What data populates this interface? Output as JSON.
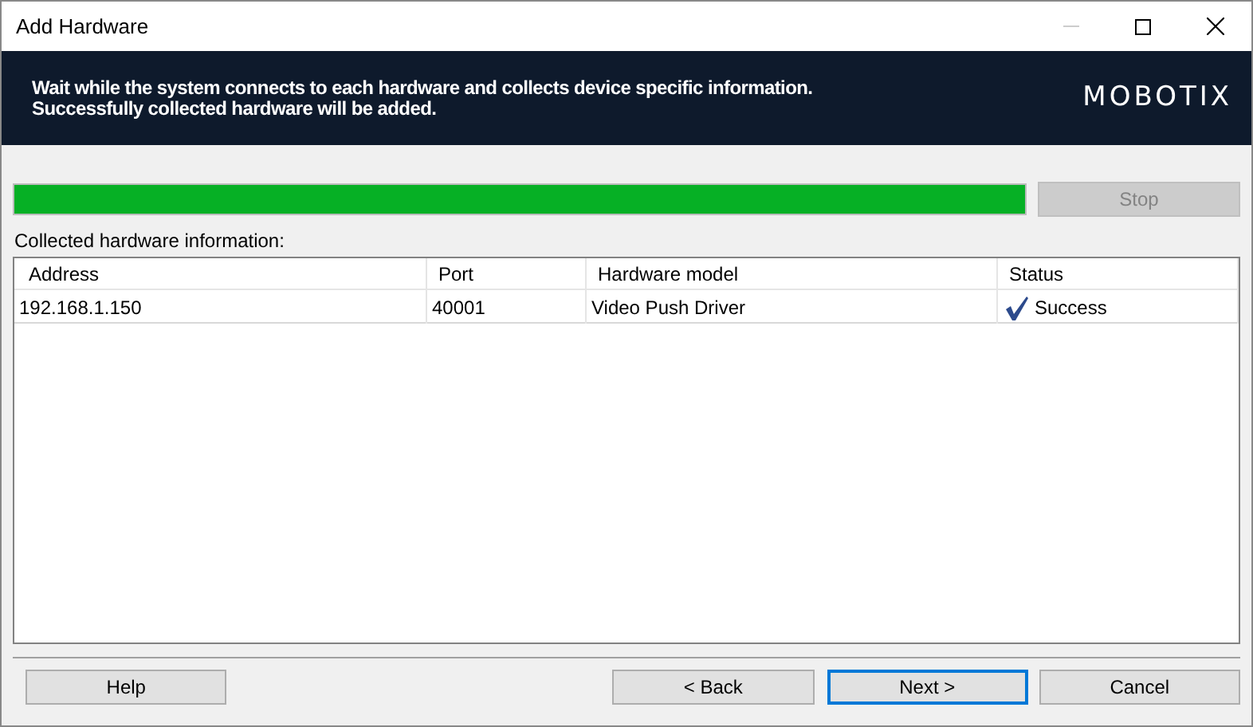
{
  "window": {
    "title": "Add Hardware"
  },
  "header": {
    "message_lines": [
      "Wait while the system connects to each hardware and collects device specific information.",
      "Successfully collected hardware will be added."
    ],
    "logo": "MOBOTIX"
  },
  "progress": {
    "level": 1
  },
  "stop_button": {
    "label": "Stop",
    "disabled": true
  },
  "table": {
    "caption": "Collected hardware information:",
    "columns": [
      "Address",
      "Port",
      "Hardware model",
      "Status"
    ],
    "rows": [
      {
        "cells": [
          "192.168.1.150",
          "40001",
          "Video Push Driver",
          "Success"
        ],
        "success": true
      }
    ]
  },
  "buttons": [
    {
      "label": "Help",
      "default": false,
      "disabled": false
    },
    {
      "label": "< Back",
      "default": false,
      "disabled": false
    },
    {
      "label": "Next >",
      "default": true,
      "disabled": false
    },
    {
      "label": "Cancel",
      "default": false,
      "disabled": false
    }
  ]
}
